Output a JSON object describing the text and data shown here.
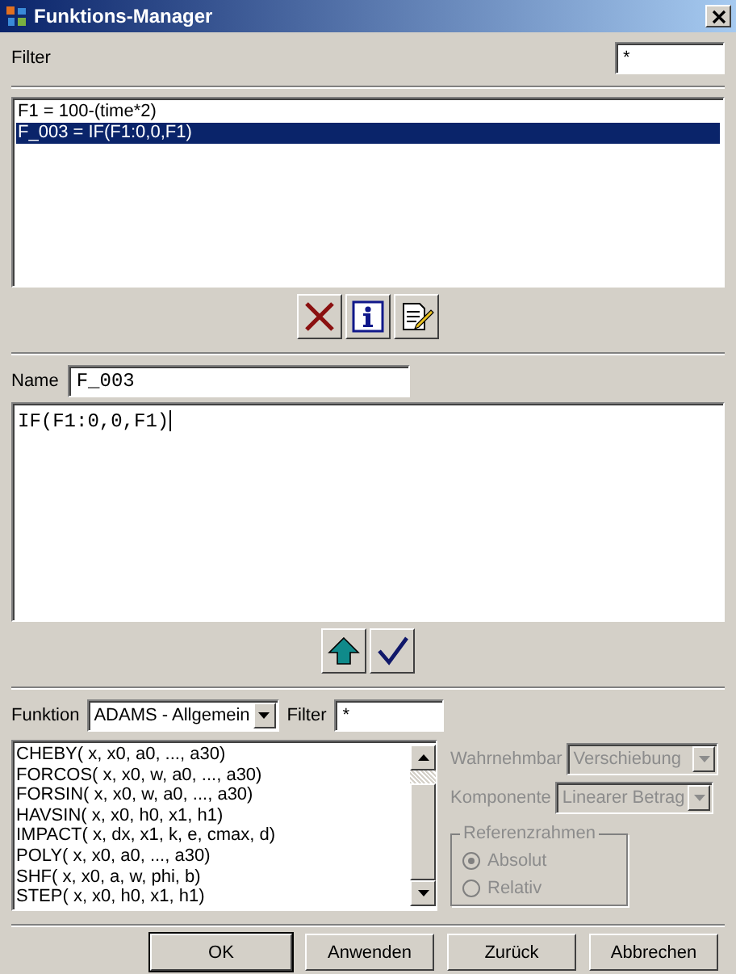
{
  "window": {
    "title": "Funktions-Manager"
  },
  "filter": {
    "label": "Filter",
    "value": "*"
  },
  "functions": [
    {
      "text": "F1 = 100-(time*2)",
      "selected": false
    },
    {
      "text": "F_003 = IF(F1:0,0,F1)",
      "selected": true
    }
  ],
  "name": {
    "label": "Name",
    "value": "F_003"
  },
  "expression": {
    "value": "IF(F1:0,0,F1)"
  },
  "library": {
    "label": "Funktion",
    "category": "ADAMS - Allgemein",
    "filter_label": "Filter",
    "filter_value": "*",
    "items": [
      "CHEBY( x, x0, a0, ..., a30)",
      "FORCOS( x, x0, w, a0, ..., a30)",
      "FORSIN( x, x0, w, a0, ..., a30)",
      "HAVSIN( x, x0, h0, x1, h1)",
      "IMPACT( x, dx, x1, k, e, cmax, d)",
      "POLY( x, x0, a0, ..., a30)",
      "SHF( x, x0, a, w, phi, b)",
      "STEP( x, x0, h0, x1, h1)"
    ]
  },
  "measure": {
    "disabled": true,
    "observable_label": "Wahrnehmbar",
    "observable": "Verschiebung",
    "component_label": "Komponente",
    "component": "Linearer Betrag",
    "frame_title": "Referenzrahmen",
    "frames": [
      {
        "label": "Absolut",
        "selected": true
      },
      {
        "label": "Relativ",
        "selected": false
      }
    ]
  },
  "buttons": [
    "OK",
    "Anwenden",
    "Zurück",
    "Abbrechen"
  ]
}
